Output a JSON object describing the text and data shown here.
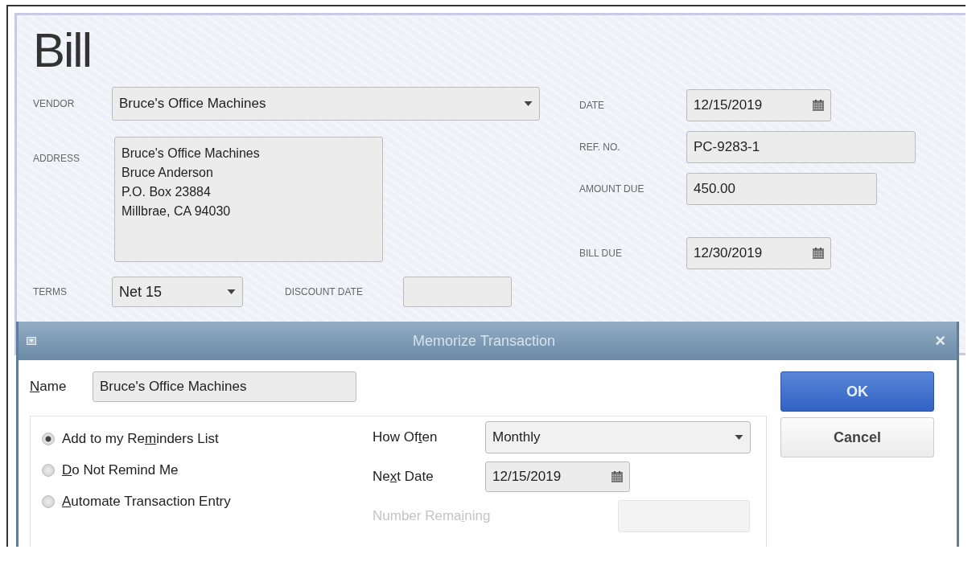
{
  "bill": {
    "title": "Bill",
    "vendor": {
      "label": "VENDOR",
      "value": "Bruce's Office Machines"
    },
    "address": {
      "label": "ADDRESS",
      "lines": [
        "Bruce's Office Machines",
        "Bruce Anderson",
        "P.O. Box 23884",
        "Millbrae, CA 94030"
      ]
    },
    "terms": {
      "label": "TERMS",
      "value": "Net 15"
    },
    "discount_date": {
      "label": "DISCOUNT DATE"
    },
    "date": {
      "label": "DATE",
      "value": "12/15/2019"
    },
    "ref_no": {
      "label": "REF. NO.",
      "value": "PC-9283-1"
    },
    "amount_due": {
      "label": "AMOUNT DUE",
      "value": "450.00"
    },
    "bill_due": {
      "label": "BILL DUE",
      "value": "12/30/2019"
    }
  },
  "dialog": {
    "title": "Memorize Transaction",
    "close": "×",
    "name": {
      "label_parts": {
        "key": "N",
        "after": "ame"
      },
      "value": "Bruce's Office Machines"
    },
    "options": [
      {
        "label_parts": {
          "before": "Add to my Re",
          "key": "m",
          "after": "inders List"
        },
        "selected": true
      },
      {
        "label_parts": {
          "key": "D",
          "after": "o Not Remind Me"
        },
        "selected": false
      },
      {
        "label_parts": {
          "key": "A",
          "after": "utomate Transaction Entry"
        },
        "selected": false
      }
    ],
    "how_often": {
      "label_parts": {
        "before": "How Of",
        "key": "t",
        "after": "en"
      },
      "value": "Monthly",
      "disabled": false
    },
    "next_date": {
      "label_parts": {
        "before": "Ne",
        "key": "x",
        "after": "t Date"
      },
      "value": "12/15/2019",
      "disabled": false
    },
    "number_remaining": {
      "label_parts": {
        "before": "Number Rema",
        "key": "i",
        "after": "ning"
      },
      "disabled": true
    },
    "buttons": [
      {
        "label": "OK",
        "kind": "primary"
      },
      {
        "label": "Cancel",
        "kind": "secondary"
      }
    ]
  }
}
